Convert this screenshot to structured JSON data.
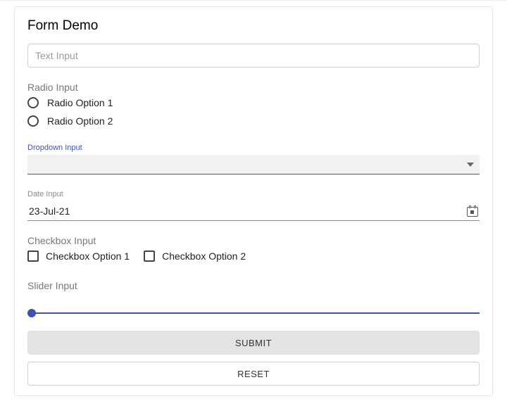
{
  "title": "Form Demo",
  "text_input": {
    "placeholder": "Text Input",
    "value": ""
  },
  "radio": {
    "label": "Radio Input",
    "options": [
      "Radio Option 1",
      "Radio Option 2"
    ]
  },
  "dropdown": {
    "label": "Dropdown Input",
    "selected": ""
  },
  "date": {
    "label": "Date Input",
    "value": "23-Jul-21"
  },
  "checkbox": {
    "label": "Checkbox Input",
    "options": [
      "Checkbox Option 1",
      "Checkbox Option 2"
    ]
  },
  "slider": {
    "label": "Slider Input"
  },
  "buttons": {
    "submit": "SUBMIT",
    "reset": "RESET"
  }
}
